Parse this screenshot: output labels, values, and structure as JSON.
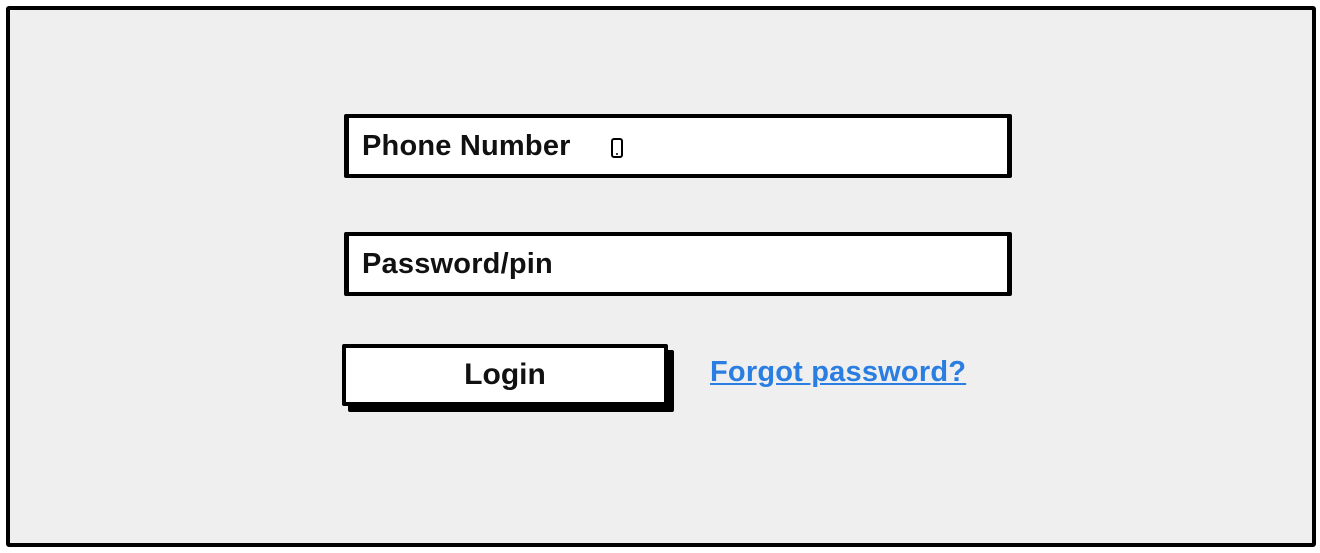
{
  "login_form": {
    "phone_field": {
      "label": "Phone Number",
      "icon": "mobile-phone-icon"
    },
    "password_field": {
      "label": "Password/pin"
    },
    "login_button": {
      "label": "Login"
    },
    "forgot_link": {
      "label": "Forgot password?",
      "color": "#2a7de1"
    }
  }
}
